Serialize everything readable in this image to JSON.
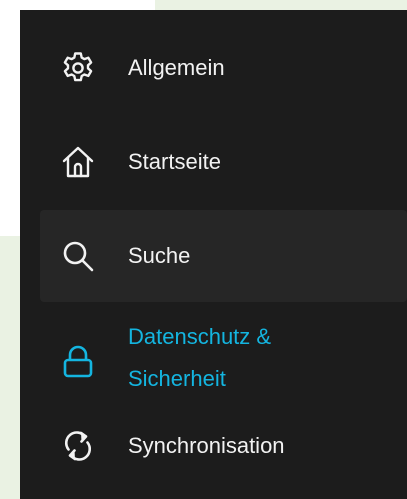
{
  "sidebar": {
    "items": [
      {
        "label": "Allgemein",
        "icon": "gear-icon"
      },
      {
        "label": "Startseite",
        "icon": "home-icon"
      },
      {
        "label": "Suche",
        "icon": "search-icon"
      },
      {
        "label": "Datenschutz & Sicherheit",
        "icon": "lock-icon",
        "selected": true
      },
      {
        "label": "Synchronisation",
        "icon": "sync-icon"
      }
    ]
  },
  "colors": {
    "sidebar_background": "#1c1c1c",
    "hover_background": "#262626",
    "text": "#f2f2f2",
    "accent": "#14b5e0",
    "page_background_tint": "#eaf2e3"
  }
}
